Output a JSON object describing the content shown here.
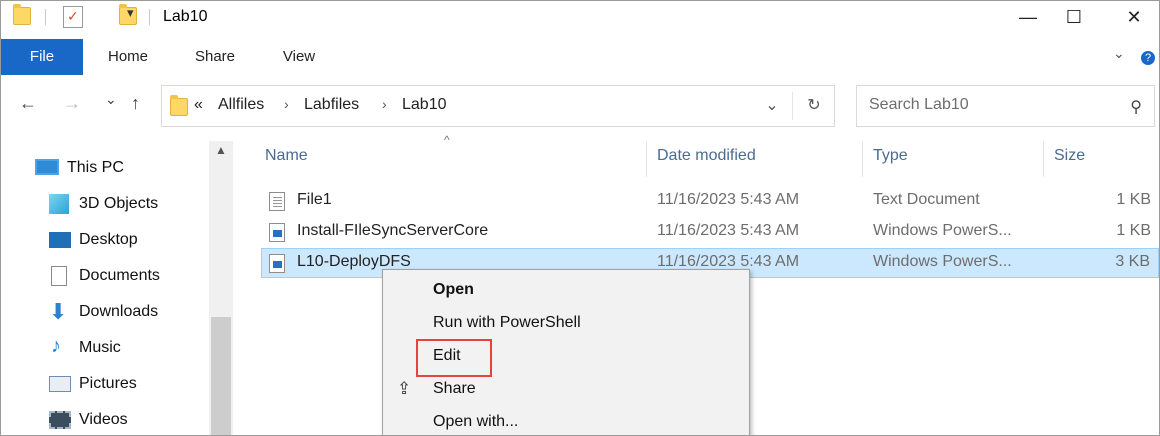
{
  "window": {
    "title": "Lab10",
    "controls": {
      "minimize": "—",
      "maximize": "☐",
      "close": "✕"
    }
  },
  "ribbon": {
    "tabs": [
      "File",
      "Home",
      "Share",
      "View"
    ],
    "expand_icon": "chevron-down-icon",
    "help_icon": "?"
  },
  "address": {
    "overflow": "«",
    "crumbs": [
      "Allfiles",
      "Labfiles",
      "Lab10"
    ],
    "separator": "›",
    "dropdown": "⌄",
    "refresh": "↻"
  },
  "search": {
    "placeholder": "Search Lab10",
    "icon": "⚲"
  },
  "nav": {
    "back": "←",
    "forward": "→",
    "recent": "⌄",
    "up": "↑"
  },
  "navpane": {
    "items": [
      {
        "label": "This PC",
        "icon": "pc-icon"
      },
      {
        "label": "3D Objects",
        "icon": "cube-icon"
      },
      {
        "label": "Desktop",
        "icon": "desktop-icon"
      },
      {
        "label": "Documents",
        "icon": "documents-icon"
      },
      {
        "label": "Downloads",
        "icon": "downloads-icon"
      },
      {
        "label": "Music",
        "icon": "music-icon"
      },
      {
        "label": "Pictures",
        "icon": "pictures-icon"
      },
      {
        "label": "Videos",
        "icon": "videos-icon"
      }
    ]
  },
  "columns": {
    "name": "Name",
    "date": "Date modified",
    "type": "Type",
    "size": "Size"
  },
  "files": [
    {
      "name": "File1",
      "date": "11/16/2023 5:43 AM",
      "type": "Text Document",
      "size": "1 KB"
    },
    {
      "name": "Install-FIleSyncServerCore",
      "date": "11/16/2023 5:43 AM",
      "type": "Windows PowerS...",
      "size": "1 KB"
    },
    {
      "name": "L10-DeployDFS",
      "date": "11/16/2023 5:43 AM",
      "type": "Windows PowerS...",
      "size": "3 KB"
    }
  ],
  "context_menu": {
    "items": [
      "Open",
      "Run with PowerShell",
      "Edit",
      "Share",
      "Open with..."
    ]
  },
  "colors": {
    "accent": "#1968c8",
    "selection": "#cce8ff",
    "highlight": "#e2453c"
  }
}
